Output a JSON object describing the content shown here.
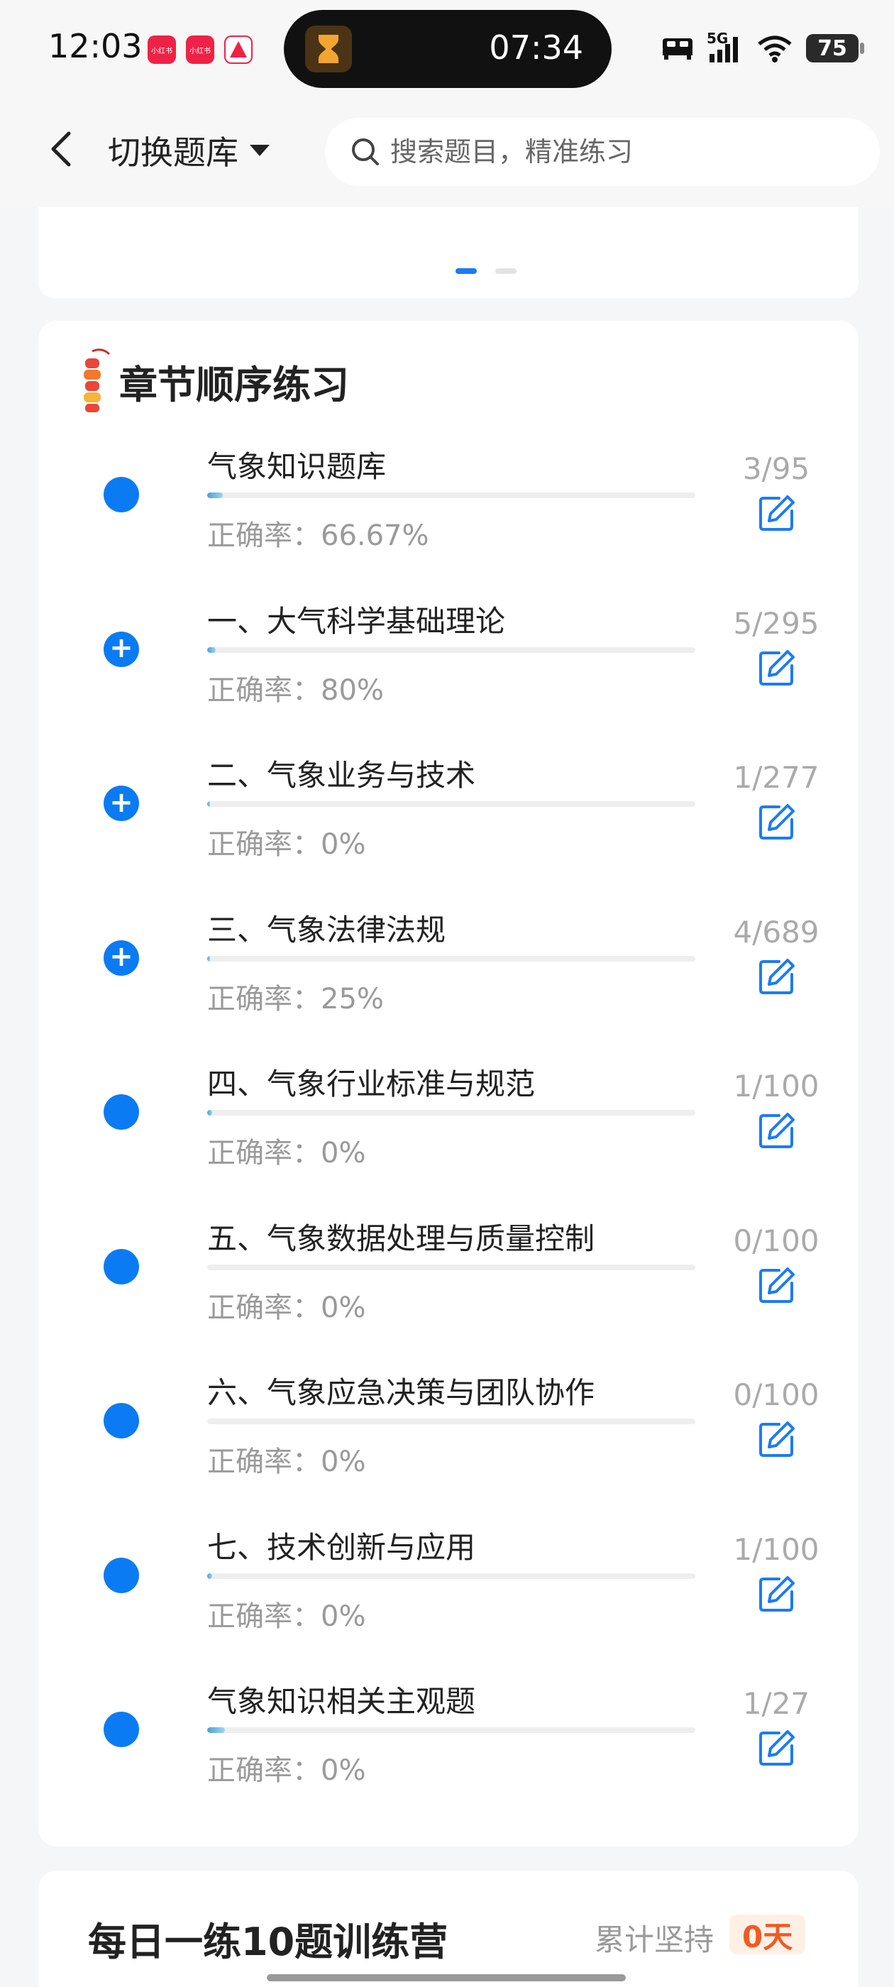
{
  "status_bar": {
    "time": "12:03",
    "app_icons": [
      "小红书",
      "小红书",
      "app"
    ],
    "island_time": "07:34",
    "network": "5G",
    "battery": "75"
  },
  "header": {
    "switch_bank_label": "切换题库",
    "search_placeholder": "搜索题目，精准练习"
  },
  "chapter_section": {
    "title": "章节顺序练习",
    "items": [
      {
        "title": "气象知识题库",
        "accuracy": "正确率：66.67%",
        "count": "3/95",
        "progress": 0.0316,
        "expandable": false
      },
      {
        "title": "一、大气科学基础理论",
        "accuracy": "正确率：80%",
        "count": "5/295",
        "progress": 0.017,
        "expandable": true
      },
      {
        "title": "二、气象业务与技术",
        "accuracy": "正确率：0%",
        "count": "1/277",
        "progress": 0.0036,
        "expandable": true
      },
      {
        "title": "三、气象法律法规",
        "accuracy": "正确率：25%",
        "count": "4/689",
        "progress": 0.0058,
        "expandable": true
      },
      {
        "title": "四、气象行业标准与规范",
        "accuracy": "正确率：0%",
        "count": "1/100",
        "progress": 0.01,
        "expandable": false
      },
      {
        "title": "五、气象数据处理与质量控制",
        "accuracy": "正确率：0%",
        "count": "0/100",
        "progress": 0,
        "expandable": false
      },
      {
        "title": "六、气象应急决策与团队协作",
        "accuracy": "正确率：0%",
        "count": "0/100",
        "progress": 0,
        "expandable": false
      },
      {
        "title": "七、技术创新与应用",
        "accuracy": "正确率：0%",
        "count": "1/100",
        "progress": 0.01,
        "expandable": false
      },
      {
        "title": "气象知识相关主观题",
        "accuracy": "正确率：0%",
        "count": "1/27",
        "progress": 0.037,
        "expandable": false
      }
    ]
  },
  "daily": {
    "title": "每日一练10题训练营",
    "streak_label": "累计坚持",
    "streak_value": "0天"
  },
  "colors": {
    "accent": "#0b7bf4",
    "progress": "#4a9fd8",
    "streak": "#f15a22"
  }
}
